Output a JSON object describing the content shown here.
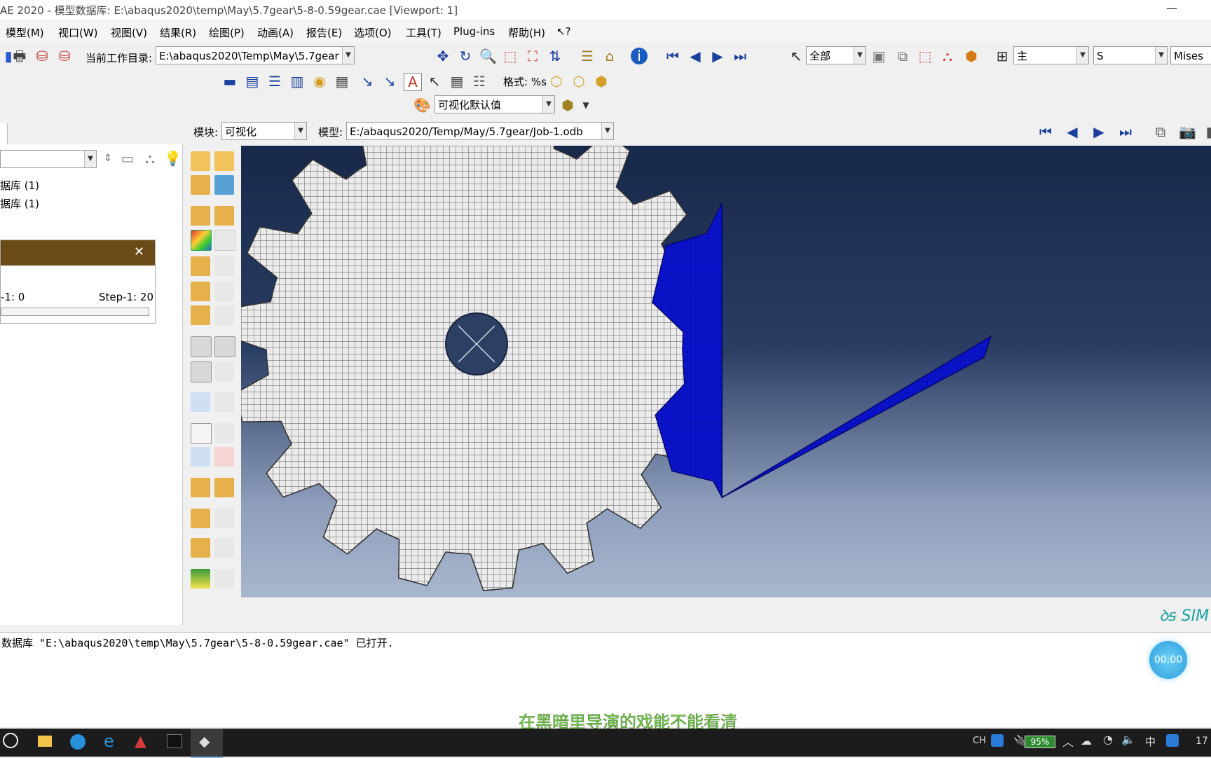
{
  "window": {
    "title": "AE 2020 - 模型数据库: E:\\abaqus2020\\temp\\May\\5.7gear\\5-8-0.59gear.cae [Viewport: 1]",
    "minimize": "—"
  },
  "menu": [
    "模型(M)",
    "视口(W)",
    "视图(V)",
    "结果(R)",
    "绘图(P)",
    "动画(A)",
    "报告(E)",
    "选项(O)",
    "工具(T)",
    "Plug-ins",
    "帮助(H)",
    "↖?"
  ],
  "toolbar": {
    "workdir_label": "当前工作目录:",
    "workdir_value": "E:\\abaqus2020\\Temp\\May\\5.7gear",
    "selection_value": "全部",
    "primary_value": "主",
    "field_value": "S",
    "invariant_value": "Mises",
    "format_label": "格式: %s",
    "vis_defaults": "可视化默认值"
  },
  "context": {
    "module_label": "模块:",
    "module_value": "可视化",
    "model_label": "模型:",
    "model_value": "E:/abaqus2020/Temp/May/5.7gear/Job-1.odb"
  },
  "tree": {
    "items": [
      "据库 (1)",
      "据库 (1)"
    ]
  },
  "dialog": {
    "left_value": "-1: 0",
    "right_value": "Step-1: 20",
    "close": "✕"
  },
  "message": "数据库 \"E:\\abaqus2020\\temp\\May\\5.7gear\\5-8-0.59gear.cae\" 已打开.",
  "subtitle": "在黑暗里导演的戏能不能看清",
  "timer": "00:00",
  "brand": "SIM",
  "taskbar": {
    "lang": "CH",
    "battery": "95%",
    "ime": "中",
    "clock": "17"
  },
  "colors": {
    "gear_fill": "#e9e9e9",
    "pinion_fill": "#0a12c8",
    "subtitle": "#7cd34a"
  }
}
